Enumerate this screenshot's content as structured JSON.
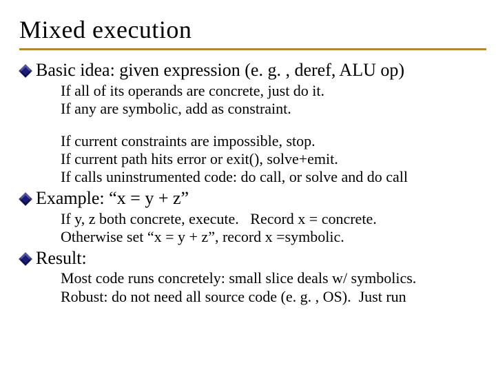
{
  "title": "Mixed execution",
  "bullets": [
    {
      "head": "Basic idea: given expression (e. g. , deref, ALU op)",
      "subs1": [
        "If all of its operands are concrete, just do it.",
        "If any are symbolic, add as constraint."
      ],
      "subs2": [
        "If current constraints are impossible, stop.",
        "If current path hits error or exit(), solve+emit.",
        "If calls uninstrumented code: do call, or solve and do call"
      ]
    },
    {
      "head": "Example: “x = y + z”",
      "subs1": [
        "If y, z both concrete, execute.   Record x = concrete.",
        "Otherwise set “x = y + z”, record x =symbolic."
      ],
      "subs2": []
    },
    {
      "head": "Result:",
      "subs1": [
        "Most code runs concretely: small slice deals w/ symbolics.",
        "Robust: do not need all source code (e. g. , OS).  Just run"
      ],
      "subs2": []
    }
  ]
}
